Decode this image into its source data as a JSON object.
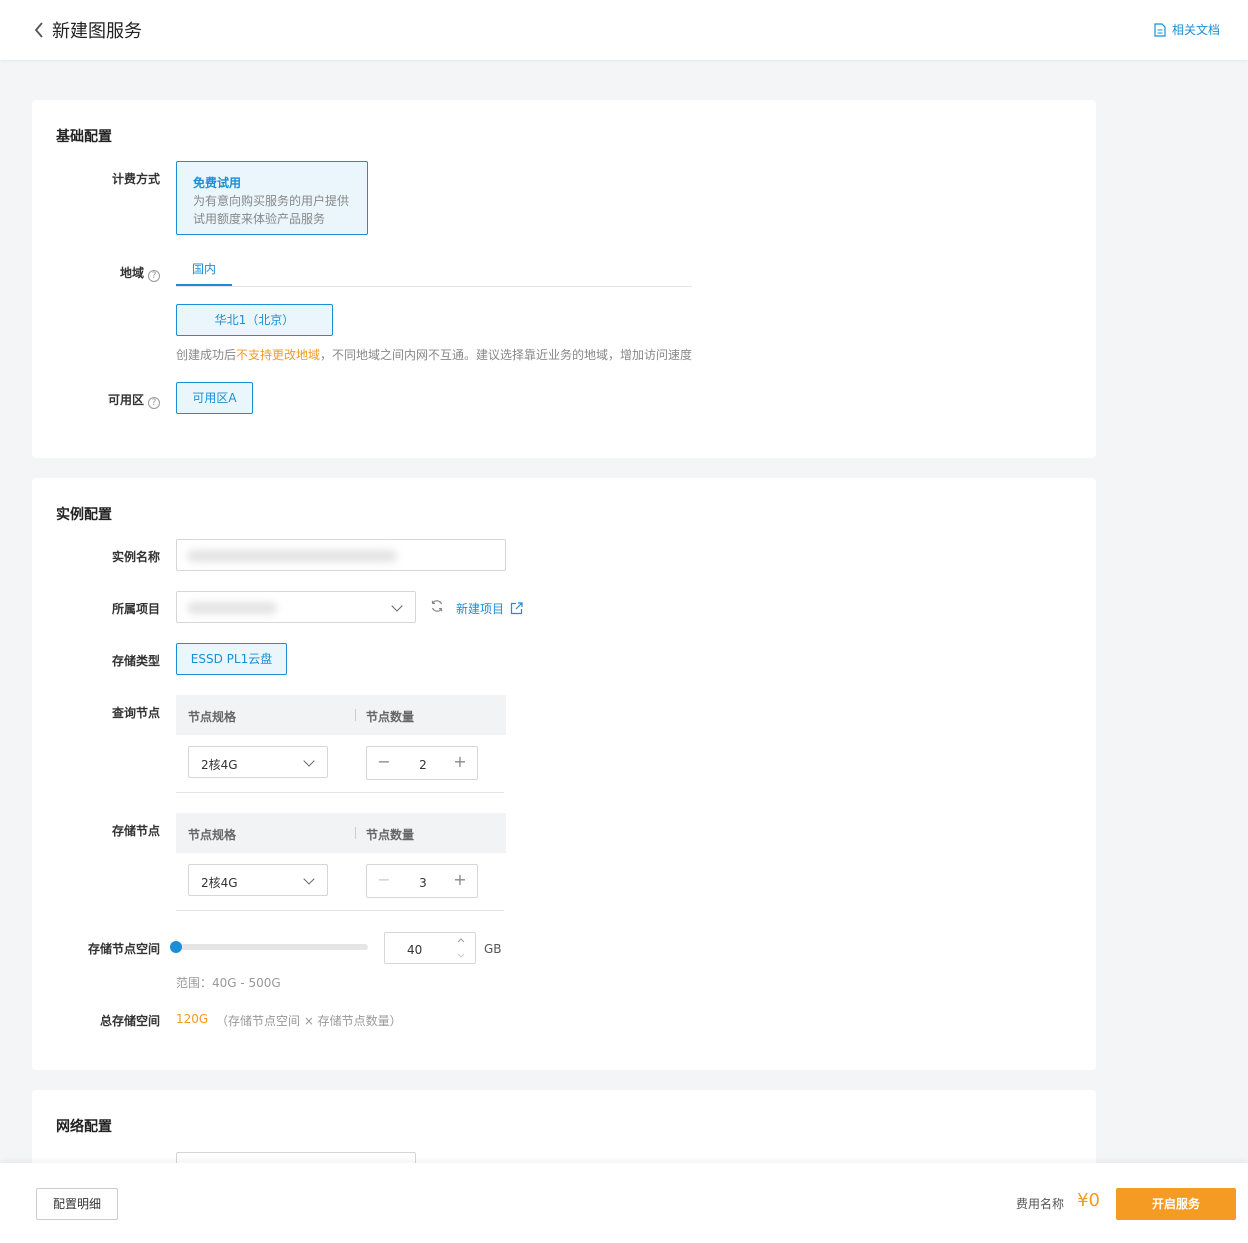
{
  "header": {
    "title": "新建图服务",
    "docs_link": "相关文档"
  },
  "basic": {
    "title": "基础配置",
    "billing_label": "计费方式",
    "billing_option": {
      "title": "免费试用",
      "desc_line1": "为有意向购买服务的用户提供",
      "desc_line2": "试用额度来体验产品服务"
    },
    "region_label": "地域",
    "region_tab": "国内",
    "region_option": "华北1（北京）",
    "region_hint_prefix": "创建成功后",
    "region_hint_warn": "不支持更改地域",
    "region_hint_suffix": "，不同地域之间内网不互通。建议选择靠近业务的地域，增加访问速度",
    "zone_label": "可用区",
    "zone_option": "可用区A"
  },
  "instance": {
    "title": "实例配置",
    "name_label": "实例名称",
    "project_label": "所属项目",
    "new_project": "新建项目",
    "storage_type_label": "存储类型",
    "storage_type_option": "ESSD PL1云盘",
    "query_node_label": "查询节点",
    "storage_node_label": "存储节点",
    "col_spec": "节点规格",
    "col_count": "节点数量",
    "query_spec": "2核4G",
    "query_count": "2",
    "storage_spec": "2核4G",
    "storage_count": "3",
    "space_label": "存储节点空间",
    "space_value": "40",
    "space_unit": "GB",
    "space_range": "范围：40G - 500G",
    "slider_level": 0,
    "total_label": "总存储空间",
    "total_value": "120G",
    "total_formula": "（存储节点空间 × 存储节点数量）"
  },
  "network": {
    "title": "网络配置"
  },
  "footer": {
    "detail_button": "配置明细",
    "fee_label": "费用名称",
    "fee_value": "¥0",
    "open_button": "开启服务"
  },
  "colors": {
    "accent": "#1a8fd6",
    "warn": "#f59a23"
  }
}
